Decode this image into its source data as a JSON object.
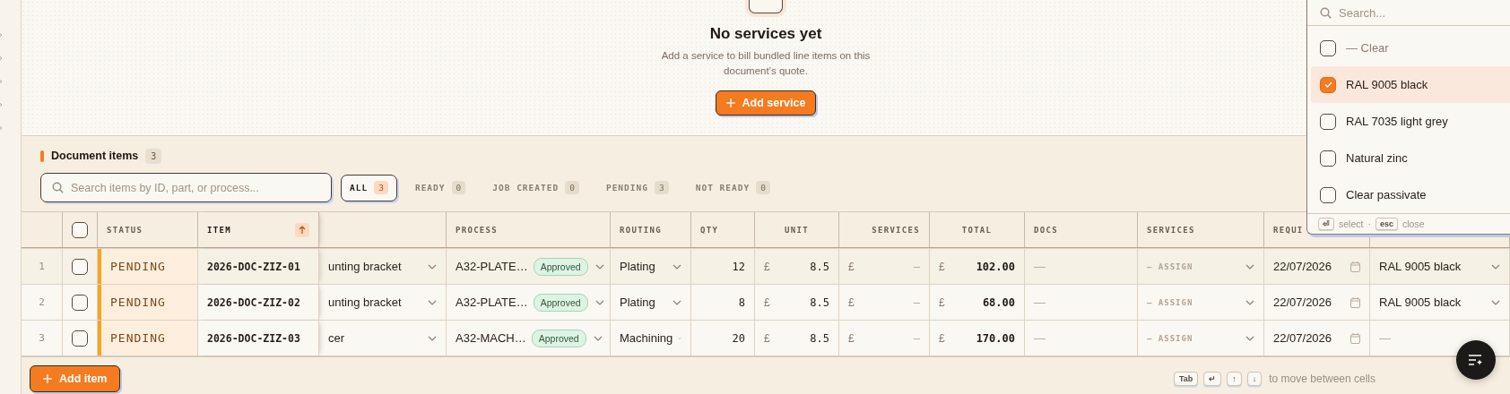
{
  "empty_state": {
    "title": "No services yet",
    "description": "Add a service to bill bundled line items on this document’s quote.",
    "button": "Add service"
  },
  "section": {
    "title": "Document items",
    "count": "3"
  },
  "search": {
    "placeholder": "Search items by ID, part, or process..."
  },
  "filters": [
    {
      "label": "ALL",
      "count": "3",
      "selected": true
    },
    {
      "label": "READY",
      "count": "0",
      "selected": false
    },
    {
      "label": "JOB CREATED",
      "count": "0",
      "selected": false
    },
    {
      "label": "PENDING",
      "count": "3",
      "selected": false
    },
    {
      "label": "NOT READY",
      "count": "0",
      "selected": false
    }
  ],
  "table": {
    "columns": [
      {
        "kind": "number"
      },
      {
        "kind": "select",
        "checked": false
      },
      {
        "kind": "text",
        "label": "STATUS"
      },
      {
        "kind": "text",
        "label": "ITEM",
        "sorted": true
      },
      {
        "kind": "blank"
      },
      {
        "kind": "text",
        "label": "PROCESS"
      },
      {
        "kind": "text",
        "label": "ROUTING"
      },
      {
        "kind": "text",
        "label": "QTY"
      },
      {
        "kind": "text",
        "label": "UNIT"
      },
      {
        "kind": "text",
        "label": "SERVICES"
      },
      {
        "kind": "text",
        "label": "TOTAL"
      },
      {
        "kind": "text",
        "label": "DOCS"
      },
      {
        "kind": "text",
        "label": "SERVICES"
      },
      {
        "kind": "text",
        "label": "REQUI"
      },
      {
        "kind": "blank"
      }
    ],
    "rows": [
      {
        "number": "1",
        "checked": false,
        "status": "PENDING",
        "item": "2026-DOC-ZIZ-01",
        "part": "unting bracket",
        "process": "A32-PLATE…",
        "approval": "Approved",
        "routing": "Plating",
        "qty": "12",
        "unit_currency": "£",
        "unit": "8.5",
        "services_currency": "£",
        "services": "—",
        "total_currency": "£",
        "total": "102.00",
        "docs": "—",
        "assign": "— ASSIGN",
        "required": "22/07/2026",
        "finish": "RAL 9005 black",
        "finish_empty": false
      },
      {
        "number": "2",
        "checked": false,
        "status": "PENDING",
        "item": "2026-DOC-ZIZ-02",
        "part": "unting bracket",
        "process": "A32-PLATE…",
        "approval": "Approved",
        "routing": "Plating",
        "qty": "8",
        "unit_currency": "£",
        "unit": "8.5",
        "services_currency": "£",
        "services": "—",
        "total_currency": "£",
        "total": "68.00",
        "docs": "—",
        "assign": "— ASSIGN",
        "required": "22/07/2026",
        "finish": "RAL 9005 black",
        "finish_empty": false
      },
      {
        "number": "3",
        "checked": false,
        "status": "PENDING",
        "item": "2026-DOC-ZIZ-03",
        "part": "cer",
        "process": "A32-MACH…",
        "approval": "Approved",
        "routing": "Machining",
        "qty": "20",
        "unit_currency": "£",
        "unit": "8.5",
        "services_currency": "£",
        "services": "—",
        "total_currency": "£",
        "total": "170.00",
        "docs": "—",
        "assign": "— ASSIGN",
        "required": "22/07/2026",
        "finish": "—",
        "finish_empty": true
      }
    ]
  },
  "add_item_button": "Add item",
  "keyboard_hint": {
    "keys": [
      "Tab",
      "↵",
      "↑",
      "↓"
    ],
    "text": "to move between cells"
  },
  "dropdown": {
    "search_placeholder": "Search...",
    "options": [
      {
        "kind": "clear",
        "label": "— Clear",
        "checked": false,
        "selected": false
      },
      {
        "kind": "option",
        "label": "RAL 9005 black",
        "checked": true,
        "selected": true
      },
      {
        "kind": "option",
        "label": "RAL 7035 light grey",
        "checked": false,
        "selected": false
      },
      {
        "kind": "option",
        "label": "Natural zinc",
        "checked": false,
        "selected": false
      },
      {
        "kind": "option",
        "label": "Clear passivate",
        "checked": false,
        "selected": false
      }
    ],
    "footer": [
      {
        "key": "⏎",
        "text": "select"
      },
      {
        "key": "esc",
        "text": "close"
      }
    ],
    "separator": "·"
  }
}
